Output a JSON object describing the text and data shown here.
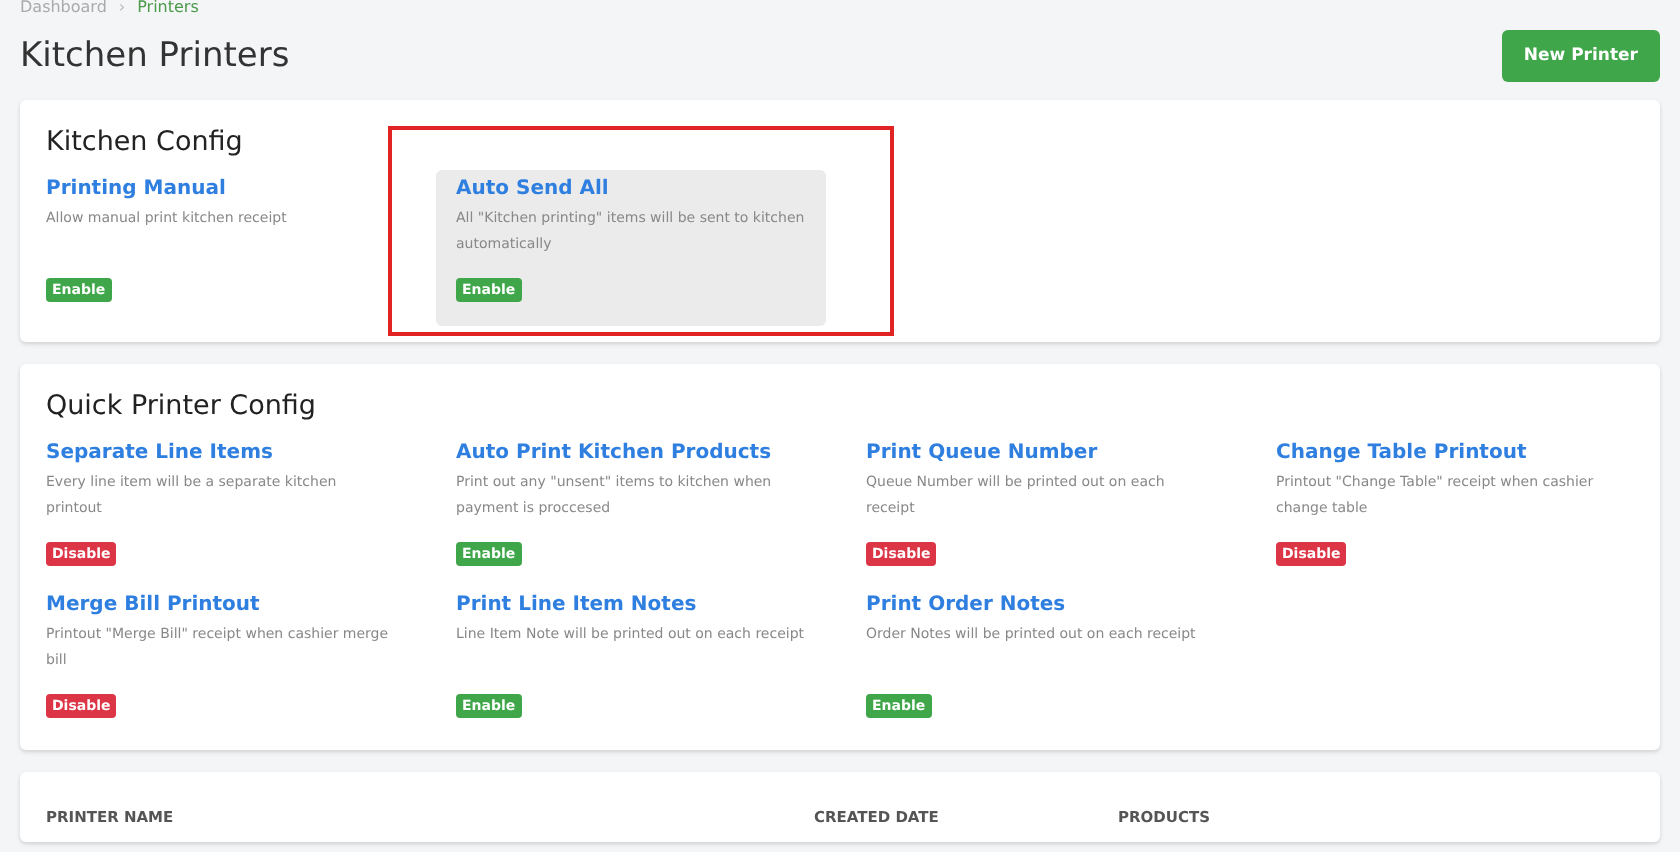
{
  "breadcrumb": [
    "Dashboard",
    "Printers"
  ],
  "breadcrumb_separator": "›",
  "page_title": "Kitchen Printers",
  "new_button": "New Printer",
  "sections": [
    {
      "title": "Kitchen Config",
      "items": [
        {
          "title": "Printing Manual",
          "description": "Allow manual print kitchen receipt",
          "enabled": true,
          "status": "Enable",
          "highlighted": false
        },
        {
          "title": "Auto Send All",
          "description": "All \"Kitchen printing\" items will be sent to kitchen automatically",
          "enabled": true,
          "status": "Enable",
          "highlighted": true
        }
      ]
    },
    {
      "title": "Quick Printer Config",
      "items": [
        {
          "title": "Separate Line Items",
          "description": "Every line item will be a separate kitchen printout",
          "enabled": false,
          "status": "Disable",
          "highlighted": false
        },
        {
          "title": "Auto Print Kitchen Products",
          "description": "Print out any \"unsent\" items to kitchen when payment is proccesed",
          "enabled": true,
          "status": "Enable",
          "highlighted": false
        },
        {
          "title": "Print Queue Number",
          "description": "Queue Number will be printed out on each receipt",
          "enabled": false,
          "status": "Disable",
          "highlighted": false
        },
        {
          "title": "Change Table Printout",
          "description": "Printout \"Change Table\" receipt when cashier change table",
          "enabled": false,
          "status": "Disable",
          "highlighted": false
        },
        {
          "title": "Merge Bill Printout",
          "description": "Printout \"Merge Bill\" receipt when cashier merge bill",
          "enabled": false,
          "status": "Disable",
          "highlighted": false
        },
        {
          "title": "Print Line Item Notes",
          "description": "Line Item Note will be printed out on each receipt",
          "enabled": true,
          "status": "Enable",
          "highlighted": false
        },
        {
          "title": "Print Order Notes",
          "description": "Order Notes will be printed out on each receipt",
          "enabled": true,
          "status": "Enable",
          "highlighted": false
        }
      ]
    }
  ],
  "table": {
    "columns": [
      "PRINTER NAME",
      "CREATED DATE",
      "PRODUCTS"
    ]
  }
}
